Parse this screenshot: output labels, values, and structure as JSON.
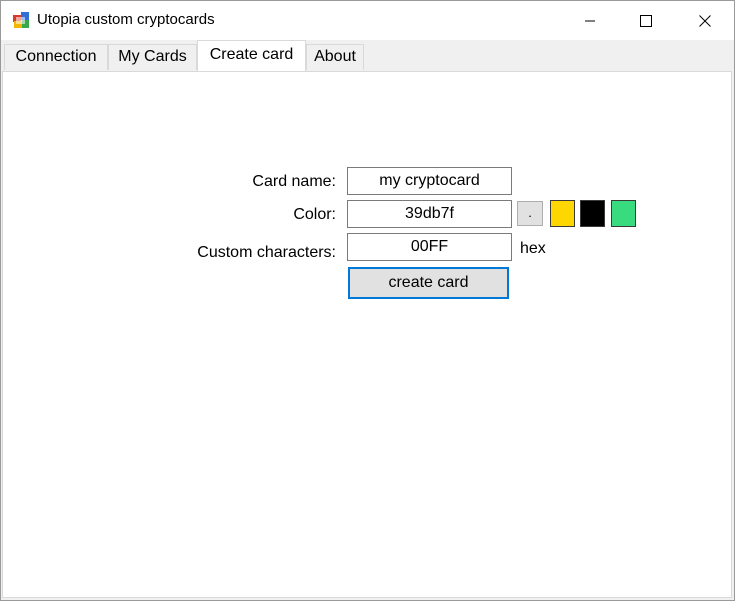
{
  "window": {
    "title": "Utopia custom cryptocards"
  },
  "tabs": [
    {
      "label": "Connection"
    },
    {
      "label": "My Cards"
    },
    {
      "label": "Create card",
      "active": true
    },
    {
      "label": "About"
    }
  ],
  "form": {
    "card_name_label": "Card name:",
    "card_name_value": "my cryptocard",
    "color_label": "Color:",
    "color_value": "39db7f",
    "color_picker_label": ".",
    "custom_chars_label": "Custom characters:",
    "custom_chars_value": "00FF",
    "custom_chars_suffix": "hex",
    "create_button_label": "create card"
  },
  "swatches": [
    {
      "name": "yellow",
      "color": "#ffd700"
    },
    {
      "name": "black",
      "color": "#000000"
    },
    {
      "name": "green",
      "color": "#39db7f"
    }
  ],
  "colors": {
    "focus_border": "#0078d7",
    "button_face": "#e1e1e1"
  }
}
